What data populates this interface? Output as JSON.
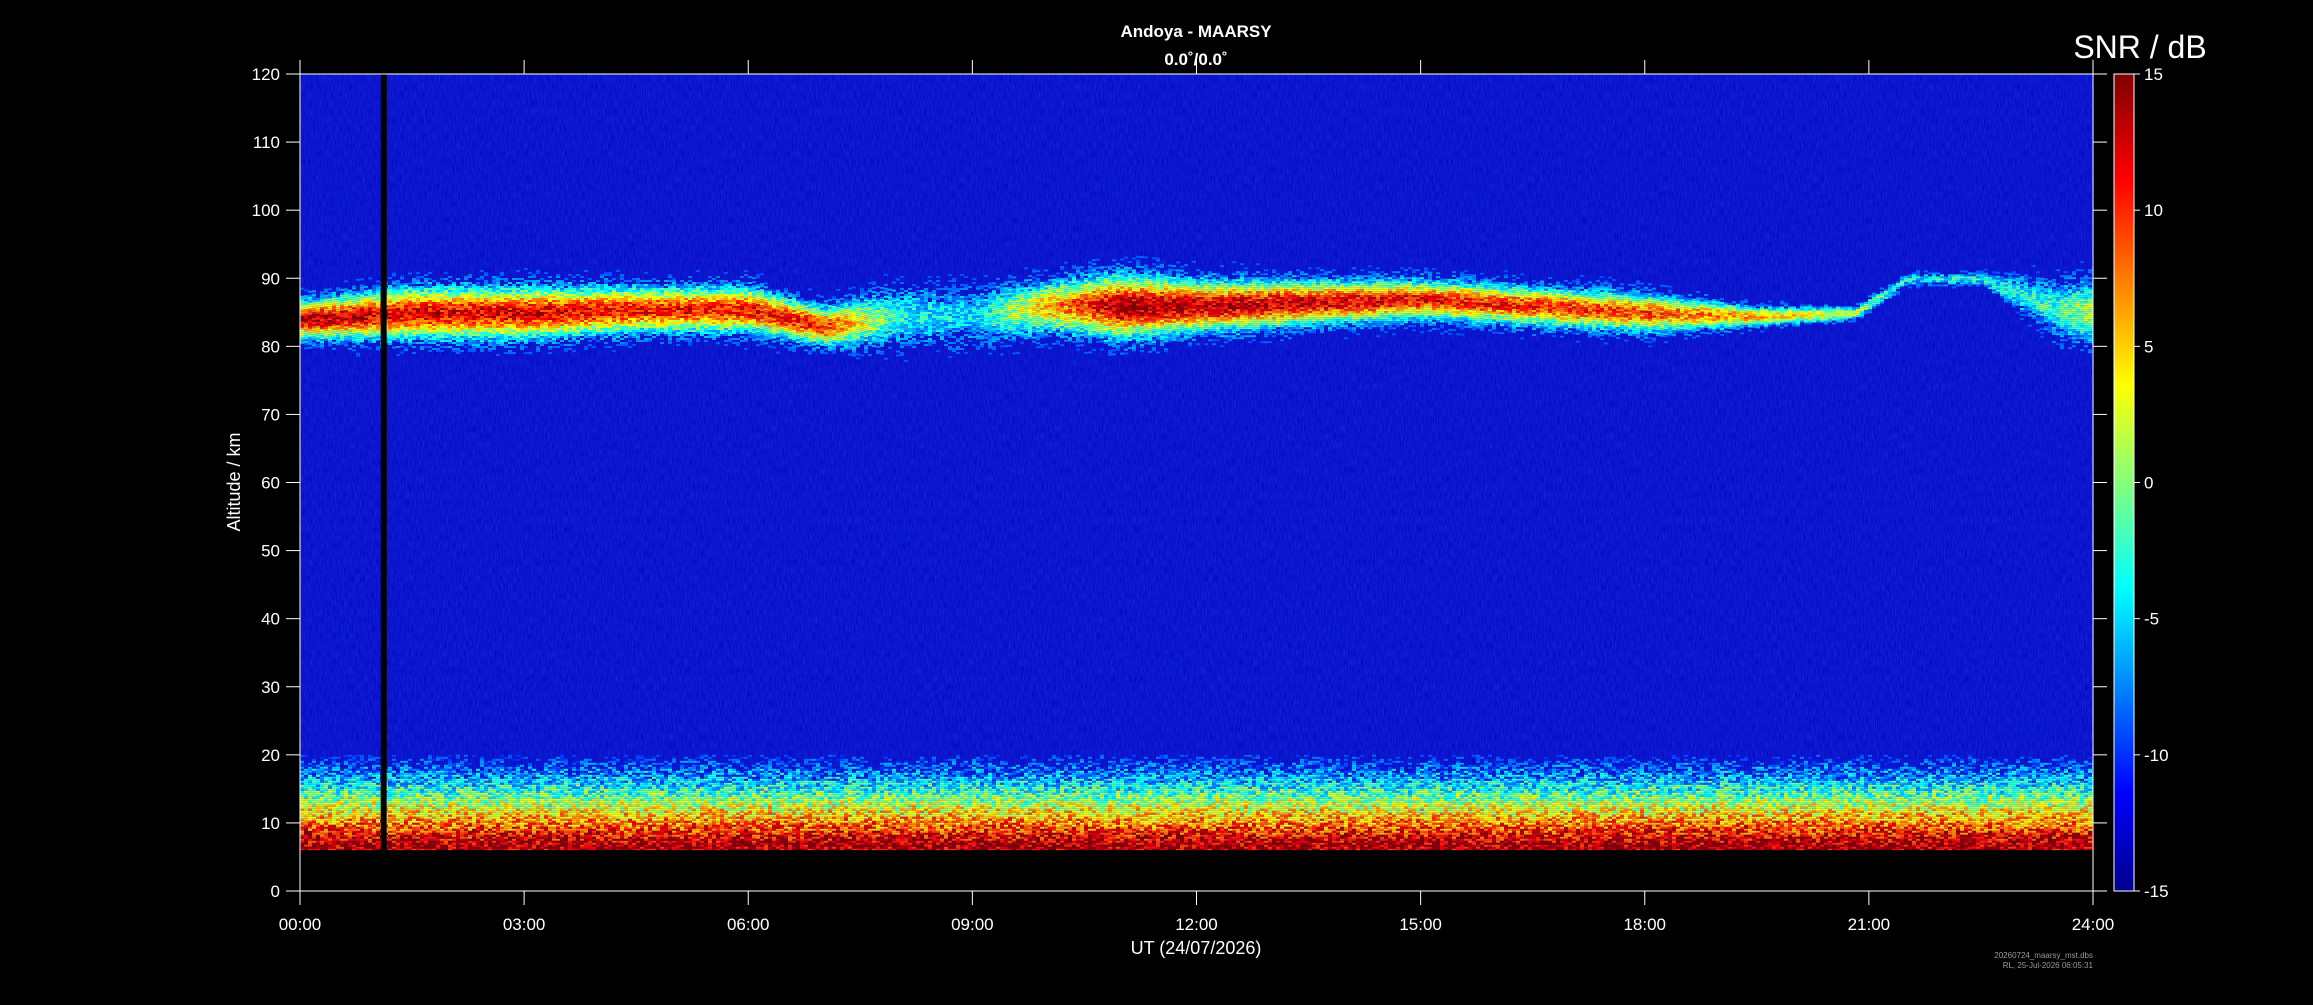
{
  "chart_data": {
    "type": "heatmap",
    "title": "Andoya - MAARSY",
    "subtitle": "0.0˚/0.0˚",
    "xlabel": "UT (24/07/2026)",
    "ylabel": "Altitude / km",
    "colorbar_label": "SNR / dB",
    "x_ticks": [
      "00:00",
      "03:00",
      "06:00",
      "09:00",
      "12:00",
      "15:00",
      "18:00",
      "21:00",
      "24:00"
    ],
    "xlim_hours": [
      0,
      24
    ],
    "y_ticks": [
      0,
      10,
      20,
      30,
      40,
      50,
      60,
      70,
      80,
      90,
      100,
      110,
      120
    ],
    "ylim_km": [
      0,
      120
    ],
    "color_ticks": [
      15,
      10,
      5,
      0,
      -5,
      -10,
      -15
    ],
    "clim_db": [
      -15,
      15
    ],
    "colormap": "jet",
    "background_snr_db": -13,
    "data_gap_hours": [
      1.08,
      1.16
    ],
    "valid_altitude_min_km": 6,
    "pmse_layer": [
      {
        "hour": 0.0,
        "base_km": 81,
        "top_km": 87,
        "peak_db": 13
      },
      {
        "hour": 1.5,
        "base_km": 81,
        "top_km": 89,
        "peak_db": 12
      },
      {
        "hour": 3.0,
        "base_km": 81,
        "top_km": 89,
        "peak_db": 12
      },
      {
        "hour": 4.5,
        "base_km": 82,
        "top_km": 89,
        "peak_db": 11
      },
      {
        "hour": 6.0,
        "base_km": 82,
        "top_km": 89,
        "peak_db": 11
      },
      {
        "hour": 7.0,
        "base_km": 80,
        "top_km": 86,
        "peak_db": 10
      },
      {
        "hour": 8.0,
        "base_km": 80,
        "top_km": 89,
        "peak_db": -3
      },
      {
        "hour": 9.0,
        "base_km": 80,
        "top_km": 89,
        "peak_db": -5
      },
      {
        "hour": 10.0,
        "base_km": 82,
        "top_km": 90,
        "peak_db": 6
      },
      {
        "hour": 11.0,
        "base_km": 81,
        "top_km": 91,
        "peak_db": 14
      },
      {
        "hour": 12.0,
        "base_km": 82,
        "top_km": 90,
        "peak_db": 13
      },
      {
        "hour": 13.5,
        "base_km": 83,
        "top_km": 90,
        "peak_db": 12
      },
      {
        "hour": 15.0,
        "base_km": 84,
        "top_km": 90,
        "peak_db": 11
      },
      {
        "hour": 16.5,
        "base_km": 83,
        "top_km": 89,
        "peak_db": 10
      },
      {
        "hour": 18.0,
        "base_km": 82,
        "top_km": 88,
        "peak_db": 9
      },
      {
        "hour": 19.5,
        "base_km": 83,
        "top_km": 86,
        "peak_db": 6
      },
      {
        "hour": 20.8,
        "base_km": 84,
        "top_km": 86,
        "peak_db": 2
      },
      {
        "hour": 21.5,
        "base_km": 89,
        "top_km": 91,
        "peak_db": -4
      },
      {
        "hour": 22.5,
        "base_km": 89,
        "top_km": 91,
        "peak_db": -3
      },
      {
        "hour": 23.5,
        "base_km": 81,
        "top_km": 90,
        "peak_db": -2
      },
      {
        "hour": 24.0,
        "base_km": 80,
        "top_km": 90,
        "peak_db": 2
      }
    ],
    "lower_atmosphere": {
      "top_km": 20,
      "peak_db": 14,
      "peak_altitude_km": 7
    }
  },
  "footer": {
    "filename": "20260724_maarsy_mst.dbs",
    "stamp": "RL, 25-Jul-2026 06:05:31"
  }
}
